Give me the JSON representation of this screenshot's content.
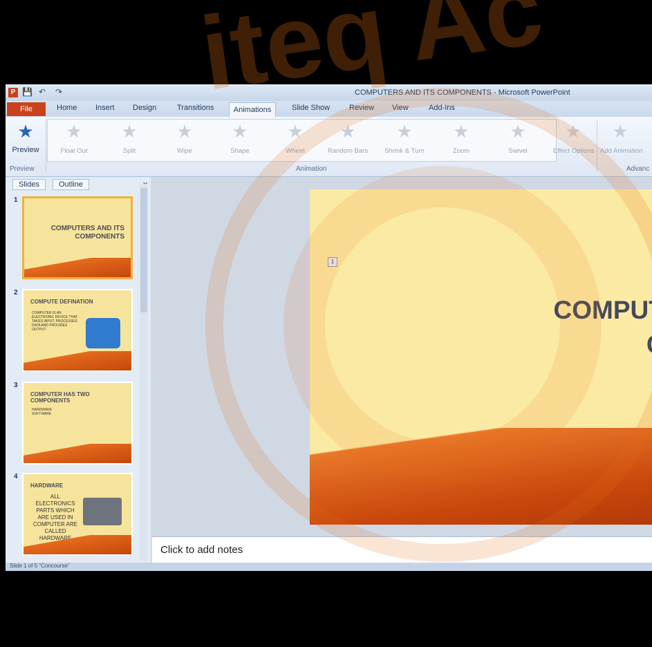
{
  "window": {
    "title": "COMPUTERS AND ITS COMPONENTS - Microsoft PowerPoint",
    "logo": "P"
  },
  "quick_access": [
    "save-icon",
    "undo-icon",
    "redo-icon"
  ],
  "tabs": [
    "File",
    "Home",
    "Insert",
    "Design",
    "Transitions",
    "Animations",
    "Slide Show",
    "Review",
    "View",
    "Add-Ins"
  ],
  "ribbon": {
    "preview_label": "Preview",
    "preview_group": "Preview",
    "animation_group": "Animation",
    "advanced_group": "Advanc",
    "animations": [
      "Float Out",
      "Split",
      "Wipe",
      "Shape",
      "Wheel",
      "Random Bars",
      "Shrink & Turn",
      "Zoom",
      "Swivel"
    ],
    "effect_options": "Effect Options",
    "add_animation": "Add Animation"
  },
  "panel": {
    "tab_slides": "Slides",
    "tab_outline": "Outline",
    "close": "×",
    "thumbs": [
      {
        "num": "1",
        "title": "COMPUTERS AND ITS COMPONENTS"
      },
      {
        "num": "2",
        "title": "COMPUTE DEFINATION",
        "body": "COMPUTER IS AN ELECTRONIC DEVICE THAT TAKES INPUT, PROCESSES DATA AND PROVIDES OUTPUT"
      },
      {
        "num": "3",
        "title": "COMPUTER HAS TWO COMPONENTS",
        "body": "HARDWARE SOFTWARE"
      },
      {
        "num": "4",
        "title": "HARDWARE",
        "body": "ALL ELECTRONICS PARTS WHICH ARE USED IN COMPUTER ARE CALLED HARDWARE"
      }
    ]
  },
  "slide": {
    "marker": "1",
    "title_line1": "COMPUTERS AND",
    "title_line2": "COMPONE"
  },
  "notes_placeholder": "Click to add notes",
  "status": "Slide 1 of 5   \"Concourse\"",
  "watermark": "iteq Ac"
}
